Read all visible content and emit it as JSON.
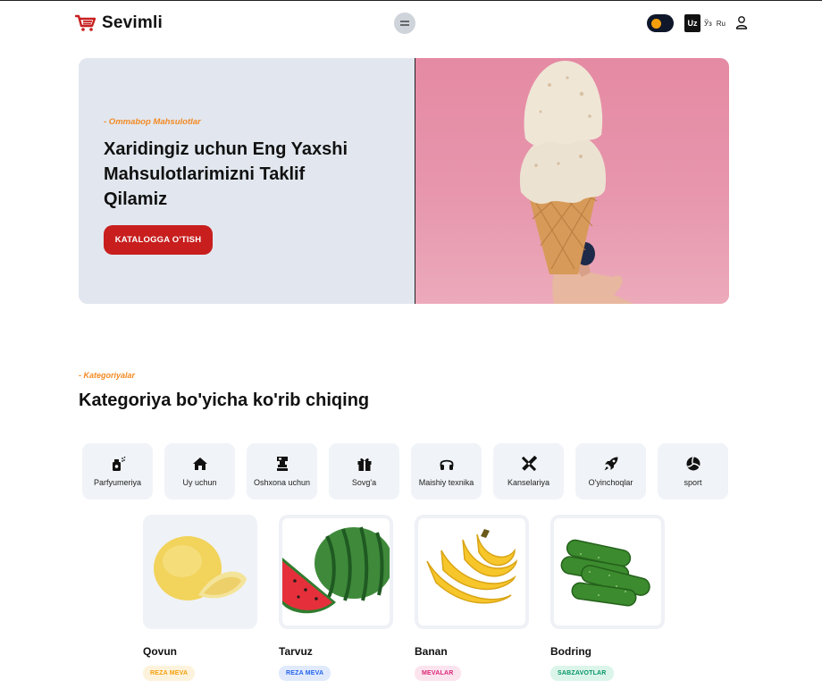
{
  "header": {
    "brand": "Sevimli",
    "languages": {
      "active": "Uz",
      "cyrillic": "Ўз",
      "russian": "Ru"
    },
    "colors": {
      "brand_red": "#c81e1e",
      "toggle_bg": "#0f172a",
      "toggle_knob": "#f59e0b"
    }
  },
  "hero": {
    "eyebrow": "- Ommabop Mahsulotlar",
    "title": "Xaridingiz uchun Eng Yaxshi Mahsulotlarimizni Taklif Qilamiz",
    "cta": "KATALOGGA O'TISH",
    "image": "ice-cream-cone"
  },
  "categories_section": {
    "eyebrow": "- Kategoriyalar",
    "title": "Kategoriya bo'yicha ko'rib chiqing",
    "categories": [
      {
        "label": "Parfyumeriya",
        "icon": "perfume-icon"
      },
      {
        "label": "Uy uchun",
        "icon": "home-icon"
      },
      {
        "label": "Oshxona uchun",
        "icon": "kitchen-icon"
      },
      {
        "label": "Sovg'a",
        "icon": "gift-icon"
      },
      {
        "label": "Maishiy texnika",
        "icon": "headphones-icon"
      },
      {
        "label": "Kanselariya",
        "icon": "ruler-pencil-icon"
      },
      {
        "label": "O'yinchoqlar",
        "icon": "rocket-icon"
      },
      {
        "label": "sport",
        "icon": "volleyball-icon"
      }
    ]
  },
  "products": [
    {
      "name": "Qovun",
      "badge": "REZA MEVA",
      "badge_color": "#f59e0b",
      "badge_bg": "#fdf3dc",
      "image": "melon"
    },
    {
      "name": "Tarvuz",
      "badge": "REZA MEVA",
      "badge_color": "#2563eb",
      "badge_bg": "#e0eafc",
      "image": "watermelon"
    },
    {
      "name": "Banan",
      "badge": "MEVALAR",
      "badge_color": "#db2777",
      "badge_bg": "#fce4ef",
      "image": "bananas"
    },
    {
      "name": "Bodring",
      "badge": "SABZAVOTLAR",
      "badge_color": "#059669",
      "badge_bg": "#dcf5ea",
      "image": "cucumbers"
    }
  ]
}
